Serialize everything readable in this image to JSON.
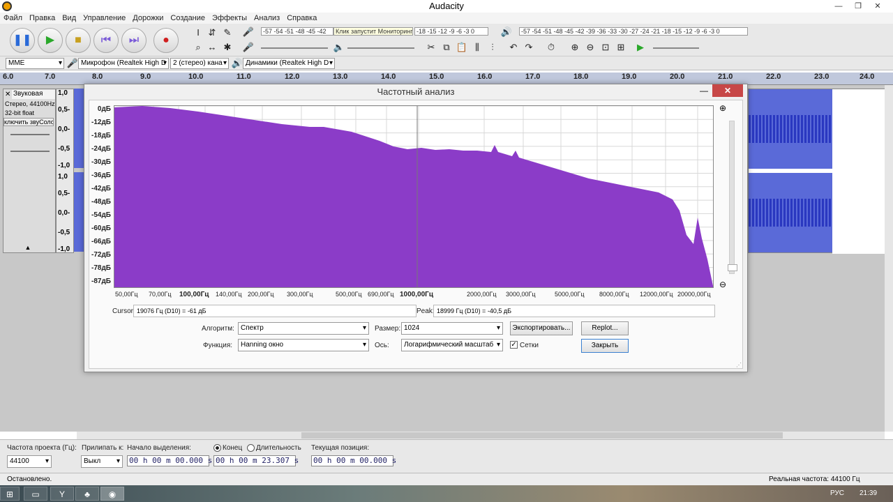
{
  "window": {
    "title": "Audacity",
    "minimize": "—",
    "maximize": "❐",
    "close": "✕"
  },
  "menu": [
    "Файл",
    "Правка",
    "Вид",
    "Управление",
    "Дорожки",
    "Создание",
    "Эффекты",
    "Анализ",
    "Справка"
  ],
  "transport": {
    "pause": "❚❚",
    "play": "▶",
    "stop": "■",
    "skip_start": "⏮",
    "skip_end": "⏭",
    "record": "●"
  },
  "meters": {
    "record_scale": "-57 -54 -51 -48 -45 -42",
    "record_tooltip": "Клик запустит Мониторинг",
    "record_scale_right": "-18 -15 -12 -9 -6 -3 0",
    "play_scale": "-57 -54 -51 -48 -45 -42 -39 -36 -33 -30 -27 -24 -21 -18 -15 -12 -9 -6 -3 0"
  },
  "devices": {
    "host": "MME",
    "mic": "Микрофон (Realtek High D",
    "channels": "2 (стерео) кана",
    "speakers": "Динамики (Realtek High D"
  },
  "ruler": [
    "6.0",
    "7.0",
    "8.0",
    "9.0",
    "10.0",
    "11.0",
    "12.0",
    "13.0",
    "14.0",
    "15.0",
    "16.0",
    "17.0",
    "18.0",
    "19.0",
    "20.0",
    "21.0",
    "22.0",
    "23.0",
    "24.0"
  ],
  "track": {
    "name": "Звуковая",
    "info1": "Стерео, 44100Hz",
    "info2": "32-bit float",
    "mute_solo": "ключить звуСоло",
    "scale": [
      "1,0",
      "0,5-",
      "0,0-",
      "-0,5",
      "-1,0",
      "1,0",
      "0,5-",
      "0,0-",
      "-0,5",
      "-1,0"
    ]
  },
  "dialog": {
    "title": "Частотный анализ",
    "y_labels": [
      "0дБ",
      "-12дБ",
      "-18дБ",
      "-24дБ",
      "-30дБ",
      "-36дБ",
      "-42дБ",
      "-48дБ",
      "-54дБ",
      "-60дБ",
      "-66дБ",
      "-72дБ",
      "-78дБ",
      "-87дБ"
    ],
    "x_labels": [
      "50,00Гц",
      "70,00Гц",
      "100,00Гц",
      "140,00Гц",
      "200,00Гц",
      "300,00Гц",
      "500,00Гц",
      "690,00Гц",
      "1000,00Гц",
      "2000,00Гц",
      "3000,00Гц",
      "5000,00Гц",
      "8000,00Гц",
      "12000,00Гц",
      "20000,00Гц"
    ],
    "cursor_label": "Cursor:",
    "cursor_value": "19076 Гц (D10) = -61 дБ",
    "peak_label": "Peak:",
    "peak_value": "18999 Гц (D10) = -40,5 дБ",
    "algorithm_label": "Алгоритм:",
    "algorithm_value": "Спектр",
    "size_label": "Размер:",
    "size_value": "1024",
    "export_button": "Экспортировать...",
    "replot_button": "Replot...",
    "function_label": "Функция:",
    "function_value": "Hanning окно",
    "axis_label": "Ось:",
    "axis_value": "Логарифмический масштаб",
    "grid_label": "Сетки",
    "grid_checked": true,
    "close_button": "Закрыть",
    "fill_color": "#8b3cc8"
  },
  "selection": {
    "rate_label": "Частота проекта (Гц):",
    "rate_value": "44100",
    "snap_label": "Прилипать к:",
    "snap_value": "Выкл",
    "start_label": "Начало выделения:",
    "end_label": "Конец",
    "length_label": "Длительность",
    "start_value": "00 h 00 m 00.000 s",
    "end_value": "00 h 00 m 23.307 s",
    "pos_label": "Текущая позиция:",
    "pos_value": "00 h 00 m 00.000 s"
  },
  "status": {
    "left": "Остановлено.",
    "right": "Реальная частота: 44100 Гц"
  },
  "taskbar": {
    "lang": "РУС",
    "time": "21:39"
  }
}
